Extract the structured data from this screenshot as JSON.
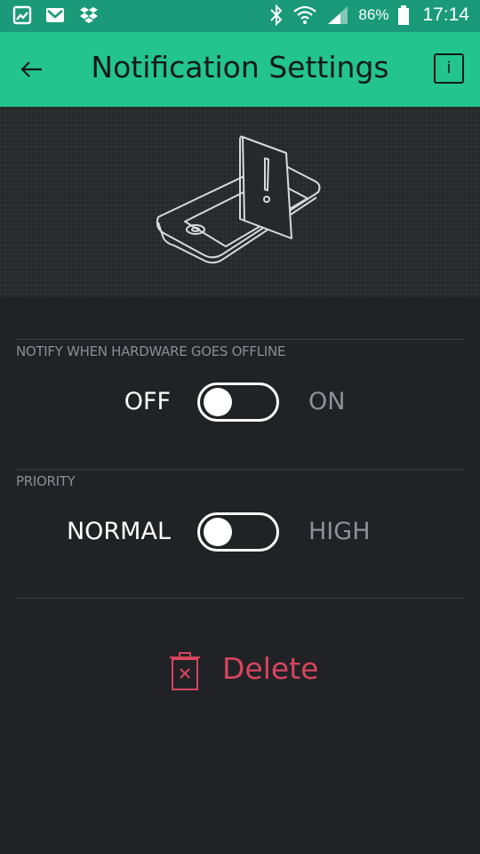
{
  "status_bar": {
    "battery_pct": "86%",
    "time": "17:14",
    "left_icons": [
      "gallery-icon",
      "gmail-icon",
      "dropbox-icon"
    ],
    "right_icons": [
      "bluetooth-icon",
      "wifi-icon",
      "signal-icon",
      "battery-icon"
    ]
  },
  "app_bar": {
    "title": "Notification Settings",
    "info_label": "i",
    "accent": "#23c48e"
  },
  "offline_section": {
    "label": "NOTIFY WHEN HARDWARE GOES OFFLINE",
    "off_label": "OFF",
    "on_label": "ON",
    "enabled": false
  },
  "priority_section": {
    "label": "PRIORITY",
    "normal_label": "NORMAL",
    "high_label": "HIGH",
    "high_enabled": false
  },
  "delete": {
    "label": "Delete",
    "color": "#d6455d"
  }
}
